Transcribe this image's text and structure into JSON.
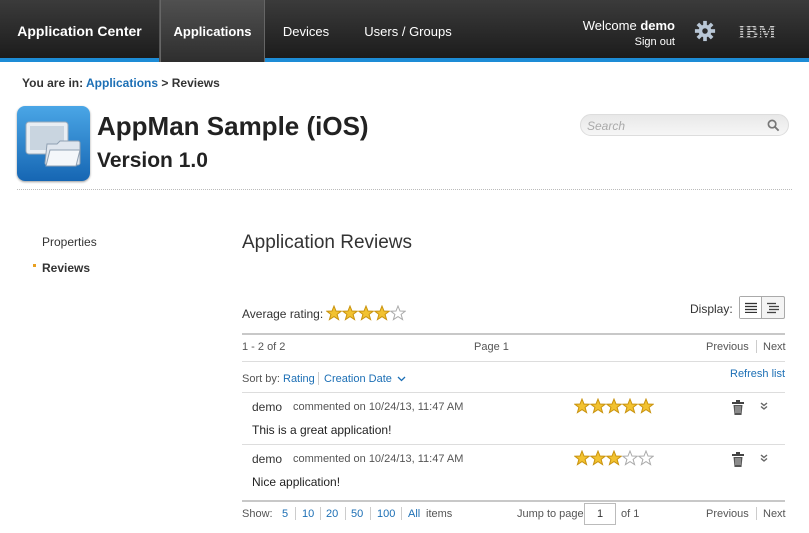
{
  "header": {
    "brand": "Application Center",
    "tabs": [
      {
        "label": "Applications",
        "active": true
      },
      {
        "label": "Devices",
        "active": false
      },
      {
        "label": "Users / Groups",
        "active": false
      }
    ],
    "welcome_prefix": "Welcome",
    "welcome_user": "demo",
    "sign_out": "Sign out",
    "logo": "IBM",
    "icons": {
      "settings": "gear-icon"
    },
    "accent_color": "#1d8cd6"
  },
  "breadcrumb": {
    "prefix": "You are in:",
    "link": "Applications",
    "separator": ">",
    "current": "Reviews"
  },
  "app": {
    "name": "AppMan Sample (iOS)",
    "version": "Version 1.0",
    "icon": "folder-window-app-icon"
  },
  "search": {
    "placeholder": "Search",
    "value": ""
  },
  "sidebar": {
    "items": [
      {
        "label": "Properties",
        "selected": false
      },
      {
        "label": "Reviews",
        "selected": true
      }
    ]
  },
  "main": {
    "title": "Application Reviews",
    "average_label": "Average rating:",
    "average_rating": 4,
    "rating_max": 5,
    "display_label": "Display:",
    "display_modes": [
      "list-view-icon",
      "detail-view-icon"
    ],
    "count_text": "1 - 2 of 2",
    "page_text": "Page 1",
    "previous": "Previous",
    "next": "Next",
    "sort_label": "Sort by:",
    "sort_options": [
      "Rating",
      "Creation Date"
    ],
    "refresh": "Refresh list"
  },
  "reviews": [
    {
      "user": "demo",
      "meta": "commented on 10/24/13, 11:47 AM",
      "text": "This is a great application!",
      "rating": 5
    },
    {
      "user": "demo",
      "meta": "commented on 10/24/13, 11:47 AM",
      "text": "Nice application!",
      "rating": 3
    }
  ],
  "footer": {
    "show_label": "Show:",
    "sizes": [
      "5",
      "10",
      "20",
      "50",
      "100",
      "All"
    ],
    "items_label": "items",
    "jump_label": "Jump to page",
    "jump_value": "1",
    "of_label": "of 1",
    "previous": "Previous",
    "next": "Next"
  }
}
